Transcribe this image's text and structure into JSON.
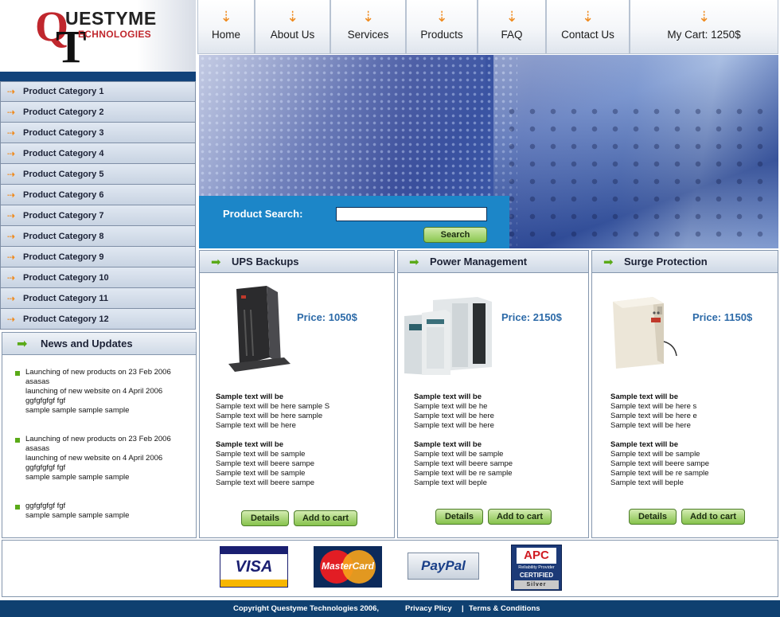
{
  "brand": {
    "line1": "UESTYME",
    "line2": "ECHNOLOGIES",
    "q": "Q",
    "t": "T"
  },
  "nav": [
    {
      "label": "Home"
    },
    {
      "label": "About Us"
    },
    {
      "label": "Services"
    },
    {
      "label": "Products"
    },
    {
      "label": "FAQ"
    },
    {
      "label": "Contact Us"
    },
    {
      "label": "My Cart: 1250$"
    }
  ],
  "sidebar": {
    "categories": [
      "Product Category 1",
      "Product Category 2",
      "Product Category 3",
      "Product Category 4",
      "Product Category 5",
      "Product Category 6",
      "Product Category 7",
      "Product Category 8",
      "Product Category 9",
      "Product Category 10",
      "Product Category 11",
      "Product Category 12"
    ]
  },
  "news": {
    "title": "News and Updates",
    "entries": [
      [
        "Launching of new products on 23 Feb 2006",
        "asasas",
        "launching of new website on 4 April 2006",
        "ggfgfgfgf fgf",
        "sample sample sample sample"
      ],
      [
        "Launching of new products on 23 Feb 2006",
        "asasas",
        "launching of new website on 4 April 2006",
        "ggfgfgfgf fgf",
        "sample sample sample sample"
      ],
      [
        "ggfgfgfgf fgf",
        "sample sample sample sample"
      ]
    ]
  },
  "search": {
    "label": "Product Search:",
    "value": "",
    "button": "Search"
  },
  "products": [
    {
      "title": "UPS Backups",
      "price": "Price: 1050$",
      "block1": [
        "Sample text will be",
        "Sample text will be here sample S",
        "Sample text will be here sample",
        "Sample text will be here"
      ],
      "block2": [
        "Sample text will be",
        "Sample text will be sample",
        "Sample text will beere sampe",
        "Sample text will be sample",
        "Sample text will beere sampe"
      ],
      "details": "Details",
      "add": "Add to cart"
    },
    {
      "title": "Power Management",
      "price": "Price: 2150$",
      "block1": [
        "Sample text will be",
        "Sample text will be he",
        "Sample text will be here",
        "Sample text will be here"
      ],
      "block2": [
        "Sample text will be",
        "Sample text will be sample",
        "Sample text will beere sampe",
        "Sample text will be re sample",
        "Sample text will beple"
      ],
      "details": "Details",
      "add": "Add to cart"
    },
    {
      "title": "Surge Protection",
      "price": "Price: 1150$",
      "block1": [
        "Sample text will be",
        "Sample text will be here s",
        "Sample text will be here e",
        "Sample text will be here"
      ],
      "block2": [
        "Sample text will be",
        "Sample text will be sample",
        "Sample text will beere sampe",
        "Sample text will be re sample",
        "Sample text will beple"
      ],
      "details": "Details",
      "add": "Add to cart"
    }
  ],
  "payments": {
    "visa": "VISA",
    "mastercard": "MasterCard",
    "paypal": "PayPal",
    "apc": {
      "name": "APC",
      "line1": "Reliability Provider",
      "line2": "CERTIFIED",
      "line3": "Silver"
    }
  },
  "footer": {
    "copyright": "Copyright Questyme Technologies 2006,",
    "privacy": "Privacy Plicy",
    "sep": "|",
    "terms": "Terms & Conditions"
  },
  "colors": {
    "accent_orange": "#ef8a1d",
    "accent_green": "#5aaa18",
    "navy": "#0f4070",
    "price_blue": "#2c6aa8"
  }
}
